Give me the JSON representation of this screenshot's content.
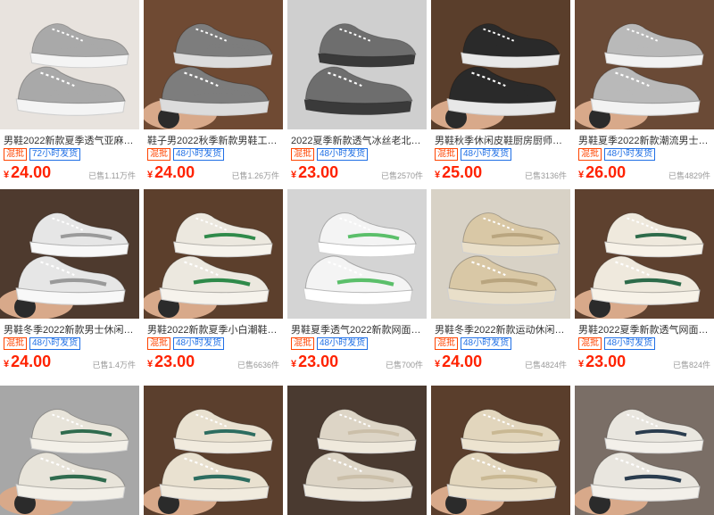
{
  "products": [
    {
      "title": "男鞋2022新款夏季透气亚麻布...",
      "tag_mix": "混批",
      "tag_ship": "72小时发货",
      "price_symbol": "¥",
      "price": "24.00",
      "sold": "已售1.11万件",
      "img": {
        "bg": "#e8e3de",
        "shoe": "#a9a9a9",
        "sole": "#f4f4f4",
        "accent": "#a9a9a9",
        "hand": false
      }
    },
    {
      "title": "鞋子男2022秋季新款男鞋工地...",
      "tag_mix": "混批",
      "tag_ship": "48小时发货",
      "price_symbol": "¥",
      "price": "24.00",
      "sold": "已售1.26万件",
      "img": {
        "bg": "#6f4a33",
        "shoe": "#7d7d7d",
        "sole": "#dcdcdc",
        "accent": "#7d7d7d",
        "hand": true
      }
    },
    {
      "title": "2022夏季新款透气冰丝老北京...",
      "tag_mix": "混批",
      "tag_ship": "48小时发货",
      "price_symbol": "¥",
      "price": "23.00",
      "sold": "已售2570件",
      "img": {
        "bg": "#cfcfcf",
        "shoe": "#6e6e6e",
        "sole": "#3a3a3a",
        "accent": "#6e6e6e",
        "hand": false
      }
    },
    {
      "title": "男鞋秋季休闲皮鞋厨房厨师防水...",
      "tag_mix": "混批",
      "tag_ship": "48小时发货",
      "price_symbol": "¥",
      "price": "25.00",
      "sold": "已售3136件",
      "img": {
        "bg": "#5a3e2b",
        "shoe": "#2a2a2a",
        "sole": "#e8e8e8",
        "accent": "#2a2a2a",
        "hand": true
      }
    },
    {
      "title": "男鞋夏季2022新款潮流男士休...",
      "tag_mix": "混批",
      "tag_ship": "48小时发货",
      "price_symbol": "¥",
      "price": "26.00",
      "sold": "已售4829件",
      "img": {
        "bg": "#6a4a36",
        "shoe": "#b9b9b9",
        "sole": "#f2f2f2",
        "accent": "#b9b9b9",
        "hand": true
      }
    },
    {
      "title": "男鞋冬季2022新款男士休闲皮...",
      "tag_mix": "混批",
      "tag_ship": "48小时发货",
      "price_symbol": "¥",
      "price": "24.00",
      "sold": "已售1.4万件",
      "img": {
        "bg": "#4e3a2e",
        "shoe": "#e6e6e6",
        "sole": "#f8f8f8",
        "accent": "#9a9a9a",
        "hand": true
      }
    },
    {
      "title": "男鞋2022新款夏季小白潮鞋运...",
      "tag_mix": "混批",
      "tag_ship": "48小时发货",
      "price_symbol": "¥",
      "price": "23.00",
      "sold": "已售6636件",
      "img": {
        "bg": "#5c3f2c",
        "shoe": "#ece8df",
        "sole": "#f6f3ec",
        "accent": "#2f8a4a",
        "hand": true
      }
    },
    {
      "title": "男鞋夏季透气2022新款网面透...",
      "tag_mix": "混批",
      "tag_ship": "48小时发货",
      "price_symbol": "¥",
      "price": "23.00",
      "sold": "已售700件",
      "img": {
        "bg": "#d4d4d4",
        "shoe": "#f4f4f4",
        "sole": "#ffffff",
        "accent": "#5bbf6a",
        "hand": false
      }
    },
    {
      "title": "男鞋冬季2022新款运动休闲鞋...",
      "tag_mix": "混批",
      "tag_ship": "48小时发货",
      "price_symbol": "¥",
      "price": "24.00",
      "sold": "已售4824件",
      "img": {
        "bg": "#d8d2c6",
        "shoe": "#d9c8a6",
        "sole": "#e9dfc9",
        "accent": "#b9a57f",
        "hand": false
      }
    },
    {
      "title": "男鞋2022夏季新款透气网面运...",
      "tag_mix": "混批",
      "tag_ship": "48小时发货",
      "price_symbol": "¥",
      "price": "23.00",
      "sold": "已售824件",
      "img": {
        "bg": "#5e412f",
        "shoe": "#efe9dd",
        "sole": "#f7f2e8",
        "accent": "#2d6b4a",
        "hand": true
      }
    },
    {
      "title": "",
      "tag_mix": "",
      "tag_ship": "",
      "price_symbol": "",
      "price": "",
      "sold": "",
      "img": {
        "bg": "#a7a7a7",
        "shoe": "#e8e4da",
        "sole": "#f3f0e8",
        "accent": "#2f6b4e",
        "hand": true
      }
    },
    {
      "title": "",
      "tag_mix": "",
      "tag_ship": "",
      "price_symbol": "",
      "price": "",
      "sold": "",
      "img": {
        "bg": "#5b3f2d",
        "shoe": "#e9e1d0",
        "sole": "#f1ebde",
        "accent": "#2d6d60",
        "hand": true
      }
    },
    {
      "title": "",
      "tag_mix": "",
      "tag_ship": "",
      "price_symbol": "",
      "price": "",
      "sold": "",
      "img": {
        "bg": "#4a3a30",
        "shoe": "#ddd5c6",
        "sole": "#efe9dc",
        "accent": "#cbbfa9",
        "hand": false
      }
    },
    {
      "title": "",
      "tag_mix": "",
      "tag_ship": "",
      "price_symbol": "",
      "price": "",
      "sold": "",
      "img": {
        "bg": "#5a3e2c",
        "shoe": "#e2d6bd",
        "sole": "#ede4d0",
        "accent": "#c9b893",
        "hand": true
      }
    },
    {
      "title": "",
      "tag_mix": "",
      "tag_ship": "",
      "price_symbol": "",
      "price": "",
      "sold": "",
      "img": {
        "bg": "#7a6e66",
        "shoe": "#e9e6df",
        "sole": "#f3f0ea",
        "accent": "#2a3c4e",
        "hand": true
      }
    }
  ]
}
